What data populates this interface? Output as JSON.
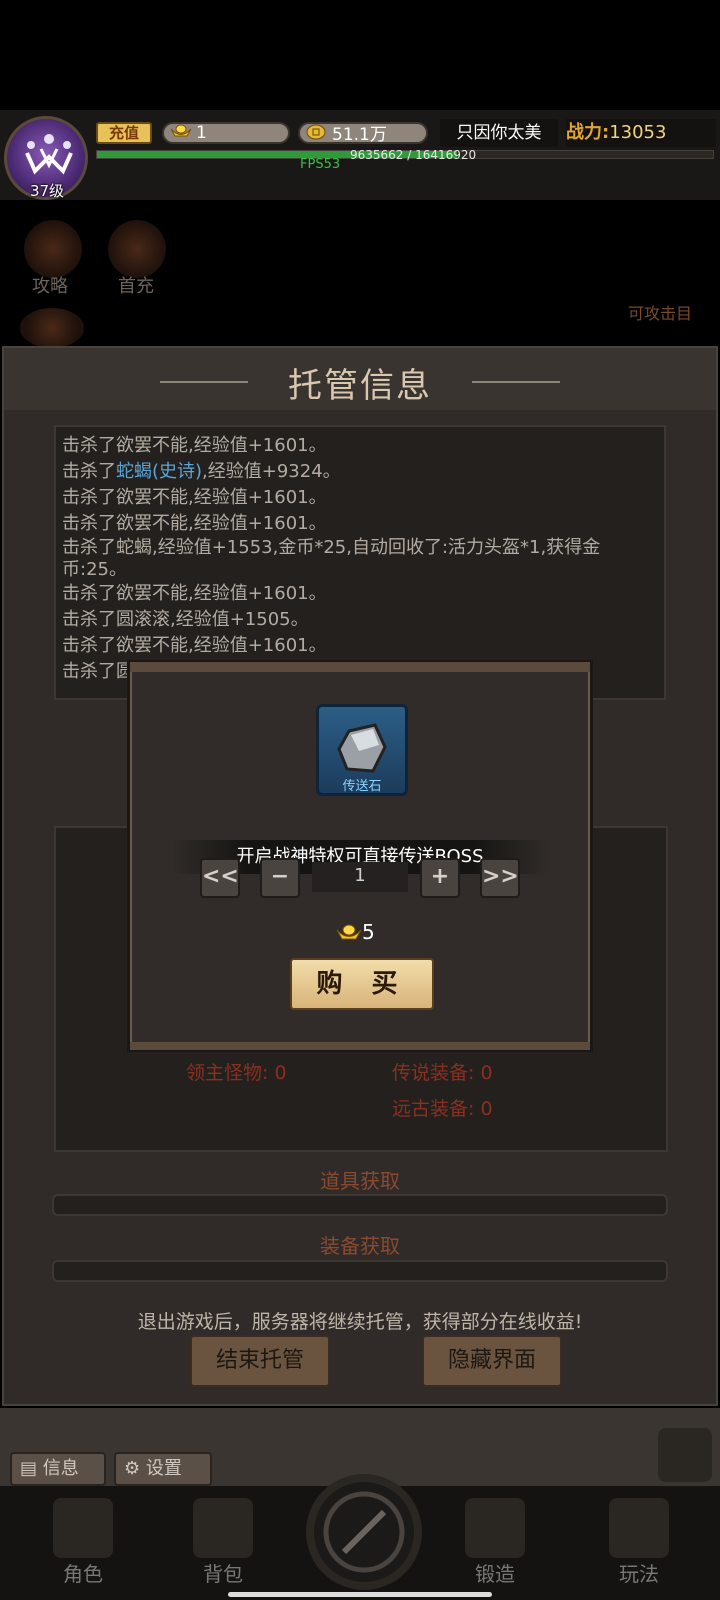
{
  "hud": {
    "recharge_label": "充值",
    "ingot_count": "1",
    "gold_amount": "51.1万",
    "player_name": "只因你太美",
    "power_label": "战力:",
    "power_value": "13053",
    "xp_text": "9635662 / 16416920",
    "xp_fraction": 0.587,
    "fps_text": "FPS53",
    "level_text": "37级"
  },
  "side_menu": {
    "guide_label": "攻略",
    "first_charge_label": "首充",
    "attack_target_label": "可攻击目"
  },
  "panel": {
    "title": "托管信息",
    "log": [
      {
        "pre": "击杀了欲罢不能,经验值+1601。",
        "name": "",
        "post": ""
      },
      {
        "pre": "击杀了",
        "name": "蛇蝎(史诗)",
        "post": ",经验值+9324。"
      },
      {
        "pre": "击杀了欲罢不能,经验值+1601。",
        "name": "",
        "post": ""
      },
      {
        "pre": "击杀了欲罢不能,经验值+1601。",
        "name": "",
        "post": ""
      },
      {
        "pre": "击杀了蛇蝎,经验值+1553,金币*25,自动回收了:活力头盔*1,获得金币:25。",
        "name": "",
        "post": ""
      },
      {
        "pre": "击杀了欲罢不能,经验值+1601。",
        "name": "",
        "post": ""
      },
      {
        "pre": "击杀了圆滚滚,经验值+1505。",
        "name": "",
        "post": ""
      },
      {
        "pre": "击杀了欲罢不能,经验值+1601。",
        "name": "",
        "post": ""
      },
      {
        "pre": "击杀了圆",
        "name": "",
        "post": ""
      }
    ],
    "boss_kills": "领主怪物: 0",
    "legend_equip": "传说装备: 0",
    "ancient_equip": "远古装备: 0",
    "items_section": "道具获取",
    "equip_section": "装备获取",
    "notice": "退出游戏后，服务器将继续托管，获得部分在线收益!",
    "end_button": "结束托管",
    "hide_button": "隐藏界面"
  },
  "bottom": {
    "info_label": "信息",
    "settings_label": "设置",
    "nav": [
      "角色",
      "背包",
      "锻造",
      "玩法"
    ]
  },
  "modal": {
    "item_name": "传送石",
    "tip": "开启战神特权可直接传送BOSS",
    "dec_many": "<<",
    "dec_one": "−",
    "quantity": "1",
    "inc_one": "+",
    "inc_many": ">>",
    "price": "5",
    "buy_label": "购 买"
  },
  "colors": {
    "panel_bg": "#302b28",
    "log_text": "#b3aba3",
    "highlight": "#5aa6d8",
    "stat_red": "#8a3020",
    "buy_button": "#e8c88f",
    "item_slot": "#2c5e86"
  }
}
